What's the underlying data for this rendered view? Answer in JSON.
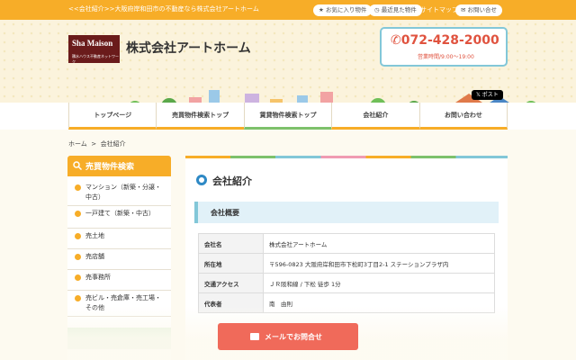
{
  "topbar": {
    "tagline": "<<会社紹介>>大阪府岸和田市の不動産なら株式会社アートホーム",
    "favorites": "お気に入り物件",
    "recent": "最近見た物件",
    "sitemap": "サイトマップ",
    "contact": "お問い合せ"
  },
  "header": {
    "logo_main": "Sha Maison",
    "logo_sub": "積水ハウス不動産ネットワーク",
    "company": "株式会社アートホーム",
    "phone": "072-428-2000",
    "hours": "営業時間/9:00～19:00",
    "post_label": "ポスト"
  },
  "nav": [
    "トップページ",
    "売買物件検索トップ",
    "賃貸物件検索トップ",
    "会社紹介",
    "お問い合わせ"
  ],
  "breadcrumb": {
    "home": "ホーム",
    "sep": ">",
    "current": "会社紹介"
  },
  "sidebar": {
    "title": "売買物件検索",
    "items": [
      "マンション（新築・分譲・中古）",
      "一戸建て（新築・中古）",
      "売土地",
      "売店舗",
      "売事務所",
      "売ビル・売倉庫・売工場・その他"
    ]
  },
  "main": {
    "title": "会社紹介",
    "subhead": "会社概要",
    "rows": [
      [
        "会社名",
        "株式会社アートホーム"
      ],
      [
        "所在地",
        "〒596-0823 大阪府岸和田市下松町3丁目2-1 ステーションプラザ内"
      ],
      [
        "交通アクセス",
        "ＪＲ阪和線 / 下松 徒歩 1分"
      ],
      [
        "代表者",
        "南　由則"
      ]
    ]
  },
  "cta": {
    "label": "メールでお問合せ"
  },
  "colors": {
    "accent": "#f7ad28",
    "green": "#7dc16b",
    "blue": "#82c7d8",
    "cta": "#f06a5a"
  }
}
